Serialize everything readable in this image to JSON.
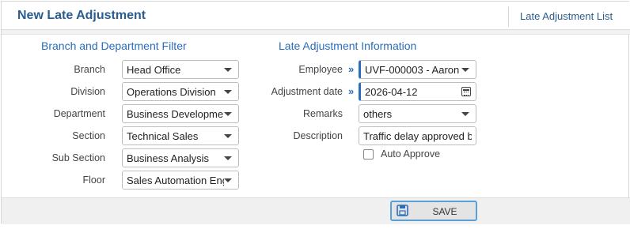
{
  "header": {
    "title": "New Late Adjustment",
    "list_link": "Late Adjustment List"
  },
  "filter": {
    "title": "Branch and Department Filter",
    "fields": [
      {
        "label": "Branch",
        "value": "Head Office"
      },
      {
        "label": "Division",
        "value": "Operations Division"
      },
      {
        "label": "Department",
        "value": "Business Developmen"
      },
      {
        "label": "Section",
        "value": "Technical Sales"
      },
      {
        "label": "Sub Section",
        "value": "Business Analysis"
      },
      {
        "label": "Floor",
        "value": "Sales Automation Eng"
      }
    ]
  },
  "info": {
    "title": "Late Adjustment Information",
    "employee": {
      "label": "Employee",
      "value": "UVF-000003 - Aaron"
    },
    "adjustment_date": {
      "label": "Adjustment date",
      "value": "2026-04-12"
    },
    "remarks": {
      "label": "Remarks",
      "value": "others"
    },
    "description": {
      "label": "Description",
      "value": "Traffic delay approved b"
    },
    "auto_approve": {
      "label": "Auto Approve",
      "checked": false
    }
  },
  "footer": {
    "save_label": "SAVE"
  },
  "colors": {
    "accent": "#2a6ebb",
    "title": "#2a5d8f"
  },
  "icons": {
    "required": "double-chevron-right-icon",
    "calendar": "calendar-icon",
    "save": "floppy-disk-icon",
    "dropdown": "caret-down-icon"
  }
}
